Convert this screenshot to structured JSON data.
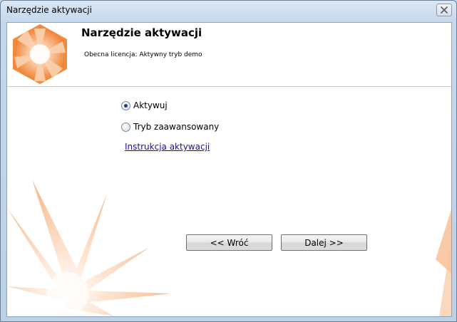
{
  "window": {
    "title": "Narzędzie aktywacji"
  },
  "header": {
    "title": "Narzędzie aktywacji",
    "license_status": "Obecna licencja: Aktywny tryb demo"
  },
  "options": [
    {
      "label": "Aktywuj",
      "selected": true
    },
    {
      "label": "Tryb zaawansowany",
      "selected": false
    }
  ],
  "link": {
    "label": "Instrukcja aktywacji"
  },
  "buttons": {
    "back": "<< Wróć",
    "next": "Dalej >>"
  },
  "icons": {
    "close": "close-icon",
    "logo": "hexagon-star-logo",
    "radio": "radio-button"
  },
  "colors": {
    "accent_orange": "#f08a3c",
    "link": "#1a0dab"
  }
}
